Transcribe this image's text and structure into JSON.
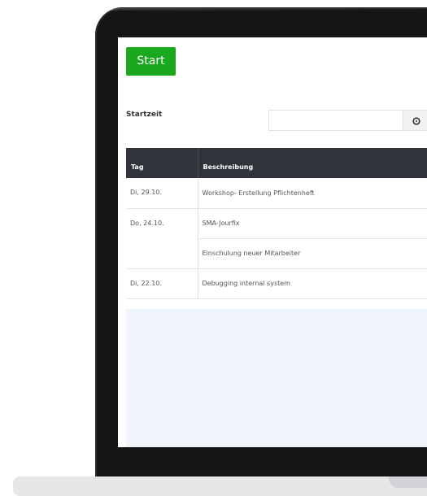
{
  "start_button": {
    "label": "Start"
  },
  "start_time": {
    "label": "Startzeit",
    "value": "",
    "placeholder": ""
  },
  "icons": {
    "time_picker": "clock-icon"
  },
  "table": {
    "columns": [
      "Tag",
      "Beschreibung"
    ],
    "rows": [
      {
        "day": "Di, 29.10.",
        "items": [
          "Workshop- Erstellung Pflichtenheft"
        ]
      },
      {
        "day": "Do, 24.10.",
        "items": [
          "SMA-Jourfix",
          "Einschulung neuer Mitarbeiter"
        ]
      },
      {
        "day": "Di, 22.10.",
        "items": [
          "Debugging internal system"
        ]
      }
    ]
  },
  "colors": {
    "accent_green": "#1ba81f",
    "table_header": "#2f353b",
    "empty_area": "#f0f5fb",
    "bezel": "#151515"
  }
}
